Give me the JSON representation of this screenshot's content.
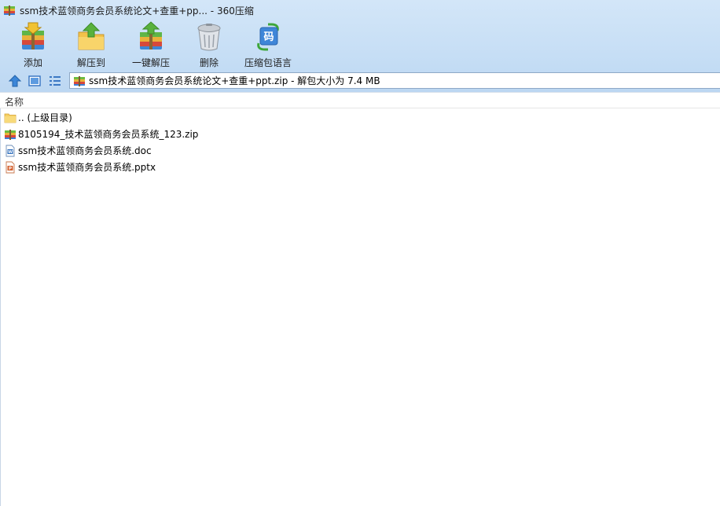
{
  "window": {
    "title": "ssm技术蓝领商务会员系统论文+查重+pp... - 360压缩"
  },
  "toolbar": {
    "buttons": [
      {
        "label": "添加",
        "icon": "add-archive-icon"
      },
      {
        "label": "解压到",
        "icon": "extract-to-icon"
      },
      {
        "label": "一键解压",
        "icon": "one-click-extract-icon"
      },
      {
        "label": "删除",
        "icon": "trash-icon"
      },
      {
        "label": "压缩包语言",
        "icon": "archive-language-icon"
      }
    ]
  },
  "navbar": {
    "up_icon": "up-arrow-icon",
    "view_icon": "thumbnail-view-icon",
    "list_icon": "list-view-icon",
    "path": "ssm技术蓝领商务会员系统论文+查重+ppt.zip - 解包大小为 7.4 MB"
  },
  "columns": {
    "name": "名称"
  },
  "files": [
    {
      "name": ".. (上级目录)",
      "icon": "folder-icon"
    },
    {
      "name": "8105194_技术蓝领商务会员系统_123.zip",
      "icon": "zip-archive-icon"
    },
    {
      "name": "ssm技术蓝领商务会员系统.doc",
      "icon": "word-doc-icon"
    },
    {
      "name": "ssm技术蓝领商务会员系统.pptx",
      "icon": "powerpoint-icon"
    }
  ],
  "colors": {
    "chrome_bg": "#c6def5",
    "path_border": "#8ea8c6"
  }
}
